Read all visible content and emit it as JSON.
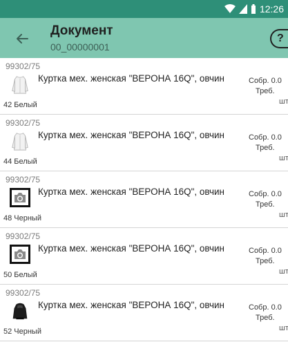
{
  "status_bar": {
    "time": "12:26"
  },
  "header": {
    "title": "Документ",
    "subtitle": "00_00000001"
  },
  "items": [
    {
      "code": "99302/75",
      "name": "Куртка мех. женская \"ВЕРОНА 16Q\", овчин",
      "size_color": "42 Белый",
      "collected": "Собр. 0.0",
      "required": "Треб.",
      "unit": "шт",
      "thumb": "jacket-white"
    },
    {
      "code": "99302/75",
      "name": "Куртка мех. женская \"ВЕРОНА 16Q\", овчин",
      "size_color": "44 Белый",
      "collected": "Собр. 0.0",
      "required": "Треб.",
      "unit": "шт",
      "thumb": "jacket-white"
    },
    {
      "code": "99302/75",
      "name": "Куртка мех. женская \"ВЕРОНА 16Q\", овчин",
      "size_color": "48 Черный",
      "collected": "Собр. 0.0",
      "required": "Треб.",
      "unit": "шт",
      "thumb": "camera-placeholder"
    },
    {
      "code": "99302/75",
      "name": "Куртка мех. женская \"ВЕРОНА 16Q\", овчин",
      "size_color": "50 Белый",
      "collected": "Собр. 0.0",
      "required": "Треб.",
      "unit": "шт",
      "thumb": "camera-placeholder"
    },
    {
      "code": "99302/75",
      "name": "Куртка мех. женская \"ВЕРОНА 16Q\", овчин",
      "size_color": "52 Черный",
      "collected": "Собр. 0.0",
      "required": "Треб.",
      "unit": "шт",
      "thumb": "jacket-black"
    }
  ]
}
